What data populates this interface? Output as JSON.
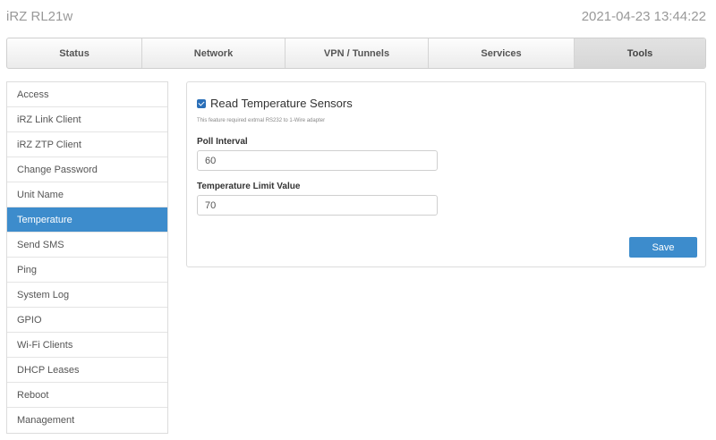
{
  "header": {
    "brand": "iRZ RL21w",
    "datetime": "2021-04-23 13:44:22"
  },
  "tabs": [
    {
      "label": "Status",
      "active": false
    },
    {
      "label": "Network",
      "active": false
    },
    {
      "label": "VPN / Tunnels",
      "active": false
    },
    {
      "label": "Services",
      "active": false
    },
    {
      "label": "Tools",
      "active": true
    }
  ],
  "sidebar": {
    "items": [
      {
        "label": "Access"
      },
      {
        "label": "iRZ Link Client"
      },
      {
        "label": "iRZ ZTP Client"
      },
      {
        "label": "Change Password"
      },
      {
        "label": "Unit Name"
      },
      {
        "label": "Temperature"
      },
      {
        "label": "Send SMS"
      },
      {
        "label": "Ping"
      },
      {
        "label": "System Log"
      },
      {
        "label": "GPIO"
      },
      {
        "label": "Wi-Fi Clients"
      },
      {
        "label": "DHCP Leases"
      },
      {
        "label": "Reboot"
      },
      {
        "label": "Management"
      }
    ],
    "active_index": 5
  },
  "panel": {
    "checkbox_label": "Read Temperature Sensors",
    "checkbox_checked": true,
    "note": "This feature required extrnal RS232 to 1-Wire adapter",
    "poll_interval_label": "Poll Interval",
    "poll_interval_value": "60",
    "temp_limit_label": "Temperature Limit Value",
    "temp_limit_value": "70",
    "save_label": "Save"
  },
  "colors": {
    "accent": "#3d8ccc",
    "checkbox": "#2a6fb8"
  }
}
